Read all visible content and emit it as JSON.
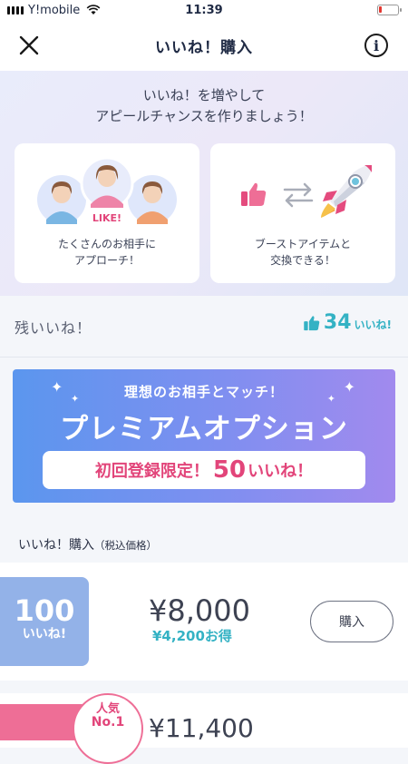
{
  "status_bar": {
    "carrier": "Y!mobile",
    "time": "11:39",
    "battery_level": 0.15
  },
  "nav": {
    "title": "いいね！購入"
  },
  "hero": {
    "text_line1": "いいね！を増やして",
    "text_line2": "アピールチャンスを作りましょう！",
    "card1": {
      "badge": "LIKE!",
      "caption_line1": "たくさんのお相手に",
      "caption_line2": "アプローチ！"
    },
    "card2": {
      "caption_line1": "ブーストアイテムと",
      "caption_line2": "交換できる！"
    }
  },
  "remaining": {
    "label": "残いいね！",
    "count": "34",
    "unit": "いいね!"
  },
  "premium": {
    "subtitle": "理想のお相手とマッチ！",
    "title": "プレミアムオプション",
    "pill_prefix": "初回登録限定！",
    "pill_number": "50",
    "pill_suffix": "いいね！"
  },
  "purchase_section": {
    "label": "いいね！購入",
    "note": "（税込価格）"
  },
  "products": [
    {
      "count": "100",
      "unit": "いいね!",
      "price": "¥8,000",
      "saving": "¥4,200お得",
      "button": "購入"
    },
    {
      "badge_line1": "人気",
      "badge_line2": "No.1",
      "price": "¥11,400"
    }
  ],
  "colors": {
    "accent": "#34b2c4",
    "pink": "#e2457a",
    "premium_start": "#5b96ee",
    "premium_end": "#a18aee"
  }
}
